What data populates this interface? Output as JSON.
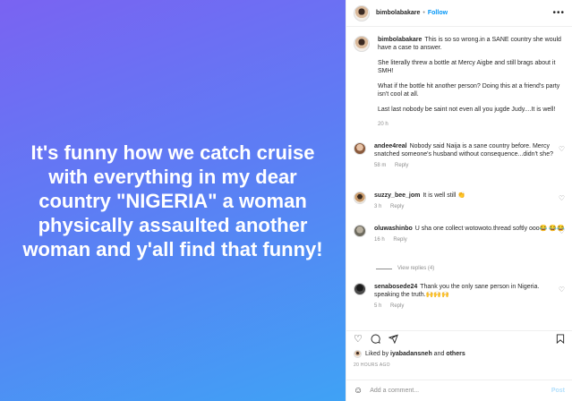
{
  "media": {
    "text": "It's funny how we catch cruise with everything in my dear country \"NIGERIA\" a woman physically assaulted another woman and y'all find that funny!"
  },
  "header": {
    "username": "bimbolabakare",
    "dot": "•",
    "follow_label": "Follow",
    "more_icon": "more-dots-icon"
  },
  "caption": {
    "username": "bimbolabakare",
    "p1": "This is so so wrong.in a SANE country she would have a case to answer.",
    "p2": "She literally threw a bottle at Mercy Aigbe and still brags about it SMH!",
    "p3": "What if the bottle hit another person? Doing this at a friend's party isn't cool at all.",
    "p4": "Last last nobody be saint not even all you jugde Judy....It is well!",
    "time": "20 h"
  },
  "comments": [
    {
      "username": "andee4real",
      "text": "Nobody said Naija is a sane country before. Mercy snatched someone's husband without consequence...didn't she?",
      "time": "58 m",
      "reply": "Reply"
    },
    {
      "username": "suzzy_bee_jom",
      "text": "It is well still 👏",
      "time": "3 h",
      "reply": "Reply"
    },
    {
      "username": "oluwashinbo",
      "text": "U sha one collect wotowoto.thread softly ooo😂 😂😂",
      "time": "16 h",
      "reply": "Reply",
      "view_replies": "View replies (4)"
    },
    {
      "username": "senabosede24",
      "text": "Thank you the only sane person in Nigeria. speaking the truth.🙌🙌🙌",
      "time": "5 h",
      "reply": "Reply"
    }
  ],
  "actions": {
    "icons": [
      "heart-icon",
      "comment-icon",
      "share-icon",
      "bookmark-icon"
    ]
  },
  "likes": {
    "prefix": "Liked by",
    "user": "iyabadansneh",
    "and": "and",
    "others": "others"
  },
  "timeago": "20 HOURS AGO",
  "add_comment": {
    "placeholder": "Add a comment...",
    "post_label": "Post"
  },
  "colors": {
    "accent": "#0095f6",
    "gradient_start": "#7a63f2",
    "gradient_end": "#3fa2f5"
  }
}
